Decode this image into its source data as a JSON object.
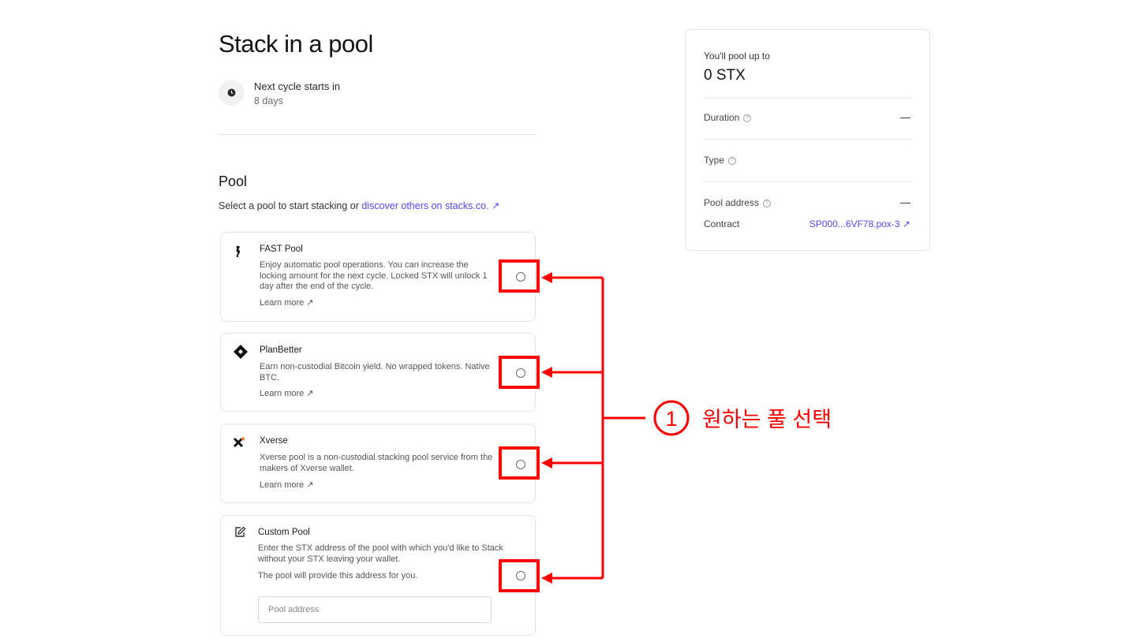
{
  "page": {
    "title": "Stack in a pool",
    "cycle_label": "Next cycle starts in",
    "cycle_value": "8 days"
  },
  "pool_section": {
    "title": "Pool",
    "intro_text": "Select a pool to start stacking or ",
    "intro_link": "discover others on stacks.co.",
    "link_arrow": "↗"
  },
  "pools": [
    {
      "name": "FAST Pool",
      "icon": "seahorse-icon",
      "description": "Enjoy automatic pool operations. You can increase the locking amount for the next cycle. Locked STX will unlock 1 day after the end of the cycle.",
      "learn_more": "Learn more ↗"
    },
    {
      "name": "PlanBetter",
      "icon": "diamond-icon",
      "description": "Earn non-custodial Bitcoin yield. No wrapped tokens. Native BTC.",
      "learn_more": "Learn more ↗"
    },
    {
      "name": "Xverse",
      "icon": "xverse-icon",
      "description": "Xverse pool is a non-custodial stacking pool service from the makers of Xverse wallet.",
      "learn_more": "Learn more ↗"
    },
    {
      "name": "Custom Pool",
      "icon": "edit-icon",
      "description": "Enter the STX address of the pool with which you'd like to Stack without your STX leaving your wallet.",
      "note": "The pool will provide this address for you.",
      "input_placeholder": "Pool address"
    }
  ],
  "summary": {
    "pool_up_to_label": "You'll pool up to",
    "amount": "0 STX",
    "duration_label": "Duration",
    "duration_value": "—",
    "type_label": "Type",
    "pool_address_label": "Pool address",
    "pool_address_value": "—",
    "contract_label": "Contract",
    "contract_value": "SP000...6VF78.pox-3 ↗",
    "help_glyph": "?"
  },
  "annotation": {
    "number": "1",
    "text": "원하는 풀 선택",
    "color": "#ff0000"
  },
  "colors": {
    "link": "#5546ff",
    "annotation": "#ff0000"
  }
}
